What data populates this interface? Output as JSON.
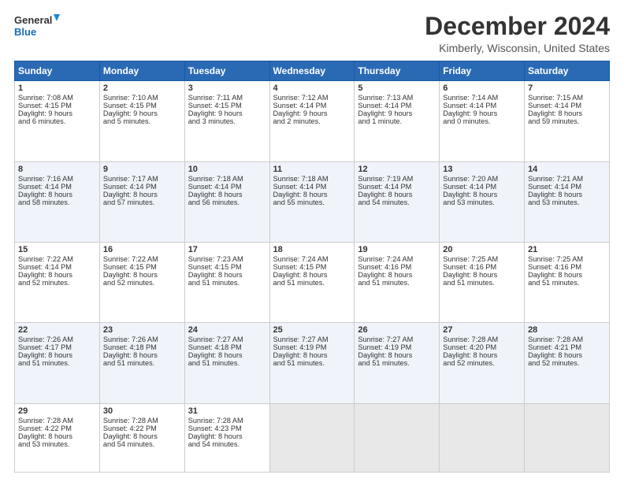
{
  "logo": {
    "line1": "General",
    "line2": "Blue"
  },
  "title": "December 2024",
  "subtitle": "Kimberly, Wisconsin, United States",
  "days_header": [
    "Sunday",
    "Monday",
    "Tuesday",
    "Wednesday",
    "Thursday",
    "Friday",
    "Saturday"
  ],
  "weeks": [
    [
      {
        "day": 1,
        "lines": [
          "Sunrise: 7:08 AM",
          "Sunset: 4:15 PM",
          "Daylight: 9 hours",
          "and 6 minutes."
        ]
      },
      {
        "day": 2,
        "lines": [
          "Sunrise: 7:10 AM",
          "Sunset: 4:15 PM",
          "Daylight: 9 hours",
          "and 5 minutes."
        ]
      },
      {
        "day": 3,
        "lines": [
          "Sunrise: 7:11 AM",
          "Sunset: 4:15 PM",
          "Daylight: 9 hours",
          "and 3 minutes."
        ]
      },
      {
        "day": 4,
        "lines": [
          "Sunrise: 7:12 AM",
          "Sunset: 4:14 PM",
          "Daylight: 9 hours",
          "and 2 minutes."
        ]
      },
      {
        "day": 5,
        "lines": [
          "Sunrise: 7:13 AM",
          "Sunset: 4:14 PM",
          "Daylight: 9 hours",
          "and 1 minute."
        ]
      },
      {
        "day": 6,
        "lines": [
          "Sunrise: 7:14 AM",
          "Sunset: 4:14 PM",
          "Daylight: 9 hours",
          "and 0 minutes."
        ]
      },
      {
        "day": 7,
        "lines": [
          "Sunrise: 7:15 AM",
          "Sunset: 4:14 PM",
          "Daylight: 8 hours",
          "and 59 minutes."
        ]
      }
    ],
    [
      {
        "day": 8,
        "lines": [
          "Sunrise: 7:16 AM",
          "Sunset: 4:14 PM",
          "Daylight: 8 hours",
          "and 58 minutes."
        ]
      },
      {
        "day": 9,
        "lines": [
          "Sunrise: 7:17 AM",
          "Sunset: 4:14 PM",
          "Daylight: 8 hours",
          "and 57 minutes."
        ]
      },
      {
        "day": 10,
        "lines": [
          "Sunrise: 7:18 AM",
          "Sunset: 4:14 PM",
          "Daylight: 8 hours",
          "and 56 minutes."
        ]
      },
      {
        "day": 11,
        "lines": [
          "Sunrise: 7:18 AM",
          "Sunset: 4:14 PM",
          "Daylight: 8 hours",
          "and 55 minutes."
        ]
      },
      {
        "day": 12,
        "lines": [
          "Sunrise: 7:19 AM",
          "Sunset: 4:14 PM",
          "Daylight: 8 hours",
          "and 54 minutes."
        ]
      },
      {
        "day": 13,
        "lines": [
          "Sunrise: 7:20 AM",
          "Sunset: 4:14 PM",
          "Daylight: 8 hours",
          "and 53 minutes."
        ]
      },
      {
        "day": 14,
        "lines": [
          "Sunrise: 7:21 AM",
          "Sunset: 4:14 PM",
          "Daylight: 8 hours",
          "and 53 minutes."
        ]
      }
    ],
    [
      {
        "day": 15,
        "lines": [
          "Sunrise: 7:22 AM",
          "Sunset: 4:14 PM",
          "Daylight: 8 hours",
          "and 52 minutes."
        ]
      },
      {
        "day": 16,
        "lines": [
          "Sunrise: 7:22 AM",
          "Sunset: 4:15 PM",
          "Daylight: 8 hours",
          "and 52 minutes."
        ]
      },
      {
        "day": 17,
        "lines": [
          "Sunrise: 7:23 AM",
          "Sunset: 4:15 PM",
          "Daylight: 8 hours",
          "and 51 minutes."
        ]
      },
      {
        "day": 18,
        "lines": [
          "Sunrise: 7:24 AM",
          "Sunset: 4:15 PM",
          "Daylight: 8 hours",
          "and 51 minutes."
        ]
      },
      {
        "day": 19,
        "lines": [
          "Sunrise: 7:24 AM",
          "Sunset: 4:16 PM",
          "Daylight: 8 hours",
          "and 51 minutes."
        ]
      },
      {
        "day": 20,
        "lines": [
          "Sunrise: 7:25 AM",
          "Sunset: 4:16 PM",
          "Daylight: 8 hours",
          "and 51 minutes."
        ]
      },
      {
        "day": 21,
        "lines": [
          "Sunrise: 7:25 AM",
          "Sunset: 4:16 PM",
          "Daylight: 8 hours",
          "and 51 minutes."
        ]
      }
    ],
    [
      {
        "day": 22,
        "lines": [
          "Sunrise: 7:26 AM",
          "Sunset: 4:17 PM",
          "Daylight: 8 hours",
          "and 51 minutes."
        ]
      },
      {
        "day": 23,
        "lines": [
          "Sunrise: 7:26 AM",
          "Sunset: 4:18 PM",
          "Daylight: 8 hours",
          "and 51 minutes."
        ]
      },
      {
        "day": 24,
        "lines": [
          "Sunrise: 7:27 AM",
          "Sunset: 4:18 PM",
          "Daylight: 8 hours",
          "and 51 minutes."
        ]
      },
      {
        "day": 25,
        "lines": [
          "Sunrise: 7:27 AM",
          "Sunset: 4:19 PM",
          "Daylight: 8 hours",
          "and 51 minutes."
        ]
      },
      {
        "day": 26,
        "lines": [
          "Sunrise: 7:27 AM",
          "Sunset: 4:19 PM",
          "Daylight: 8 hours",
          "and 51 minutes."
        ]
      },
      {
        "day": 27,
        "lines": [
          "Sunrise: 7:28 AM",
          "Sunset: 4:20 PM",
          "Daylight: 8 hours",
          "and 52 minutes."
        ]
      },
      {
        "day": 28,
        "lines": [
          "Sunrise: 7:28 AM",
          "Sunset: 4:21 PM",
          "Daylight: 8 hours",
          "and 52 minutes."
        ]
      }
    ],
    [
      {
        "day": 29,
        "lines": [
          "Sunrise: 7:28 AM",
          "Sunset: 4:22 PM",
          "Daylight: 8 hours",
          "and 53 minutes."
        ]
      },
      {
        "day": 30,
        "lines": [
          "Sunrise: 7:28 AM",
          "Sunset: 4:22 PM",
          "Daylight: 8 hours",
          "and 54 minutes."
        ]
      },
      {
        "day": 31,
        "lines": [
          "Sunrise: 7:28 AM",
          "Sunset: 4:23 PM",
          "Daylight: 8 hours",
          "and 54 minutes."
        ]
      },
      null,
      null,
      null,
      null
    ]
  ]
}
